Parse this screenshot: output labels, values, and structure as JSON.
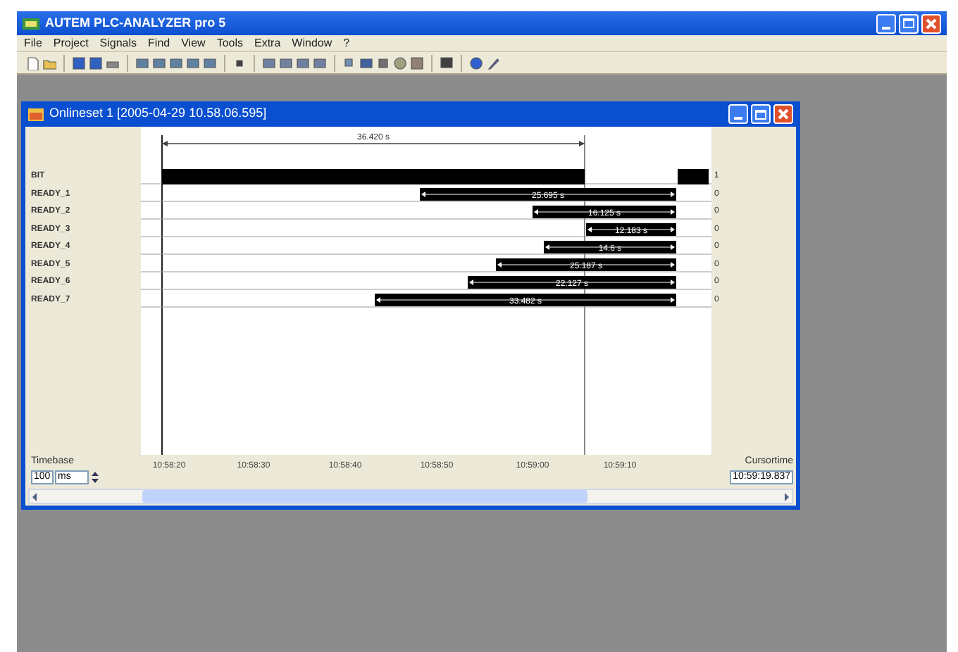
{
  "window": {
    "title": "AUTEM PLC-ANALYZER pro 5"
  },
  "menu": [
    "File",
    "Project",
    "Signals",
    "Find",
    "View",
    "Tools",
    "Extra",
    "Window",
    "?"
  ],
  "document": {
    "title": "Onlineset 1 [2005-04-29 10.58.06.595]",
    "measurement": "36.420 s",
    "signals": [
      {
        "name": "BIT",
        "value": "1"
      },
      {
        "name": "READY_1",
        "value": "0",
        "duration": "25.695 s"
      },
      {
        "name": "READY_2",
        "value": "0",
        "duration": "16.125 s"
      },
      {
        "name": "READY_3",
        "value": "0",
        "duration": "12.183 s"
      },
      {
        "name": "READY_4",
        "value": "0",
        "duration": "14.6 s"
      },
      {
        "name": "READY_5",
        "value": "0",
        "duration": "25.187 s"
      },
      {
        "name": "READY_6",
        "value": "0",
        "duration": "22.127 s"
      },
      {
        "name": "READY_7",
        "value": "0",
        "duration": "33.482 s"
      }
    ],
    "time_axis": [
      "10:58:20",
      "10:58:30",
      "10:58:40",
      "10:58:50",
      "10:59:00",
      "10:59:10"
    ],
    "timebase": {
      "label": "Timebase",
      "value": "100",
      "unit": "ms"
    },
    "cursor_time": {
      "label": "Cursortime",
      "value": "10:59:19.837"
    }
  }
}
